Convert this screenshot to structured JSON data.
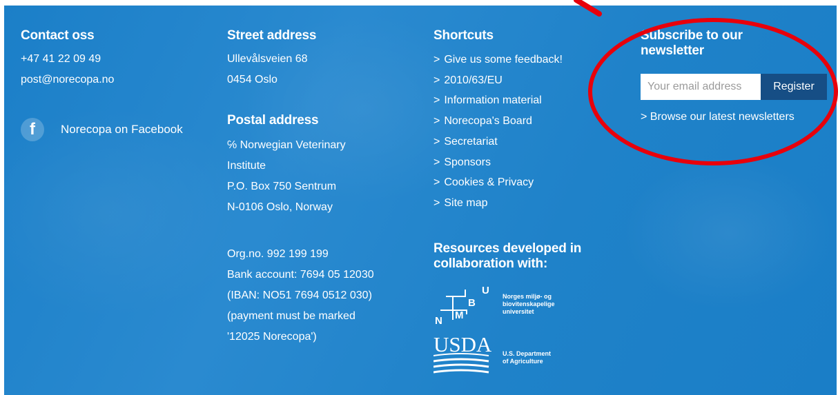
{
  "contact": {
    "heading": "Contact oss",
    "phone": "+47 41 22 09 49",
    "email": "post@norecopa.no",
    "facebook_label": "Norecopa on Facebook"
  },
  "street": {
    "heading": "Street address",
    "lines": [
      "Ullevålsveien 68",
      "0454 Oslo"
    ]
  },
  "postal": {
    "heading": "Postal address",
    "lines": [
      "℅ Norwegian Veterinary",
      "Institute",
      "P.O. Box 750 Sentrum",
      "N-0106 Oslo, Norway"
    ]
  },
  "org": {
    "lines": [
      "Org.no. 992 199 199",
      "Bank account: 7694 05 12030",
      "(IBAN: NO51 7694 0512 030)",
      "(payment must be marked",
      "'12025 Norecopa')"
    ]
  },
  "shortcuts": {
    "heading": "Shortcuts",
    "chevron": ">",
    "items": [
      "Give us some feedback!",
      "2010/63/EU",
      "Information material",
      "Norecopa's Board",
      "Secretariat",
      "Sponsors",
      "Cookies & Privacy",
      "Site map"
    ]
  },
  "resources": {
    "heading_line1": "Resources developed in",
    "heading_line2": "collaboration with:",
    "nmbu": {
      "letters": [
        "U",
        "B",
        "M",
        "N"
      ],
      "text": [
        "Norges miljø- og",
        "biovitenskapelige",
        "universitet"
      ]
    },
    "usda": {
      "mark": "USDA",
      "text": [
        "U.S. Department",
        "of Agriculture"
      ]
    }
  },
  "newsletter": {
    "heading_line1": "Subscribe to our",
    "heading_line2": "newsletter",
    "placeholder": "Your email address",
    "register_label": "Register",
    "browse_label": "> Browse our latest newsletters"
  },
  "colors": {
    "background": "#1f82c9",
    "register_button": "#164e85",
    "annotation": "#e8000b"
  },
  "icons": {
    "facebook": "facebook-icon",
    "chevron": "chevron-right-icon"
  }
}
